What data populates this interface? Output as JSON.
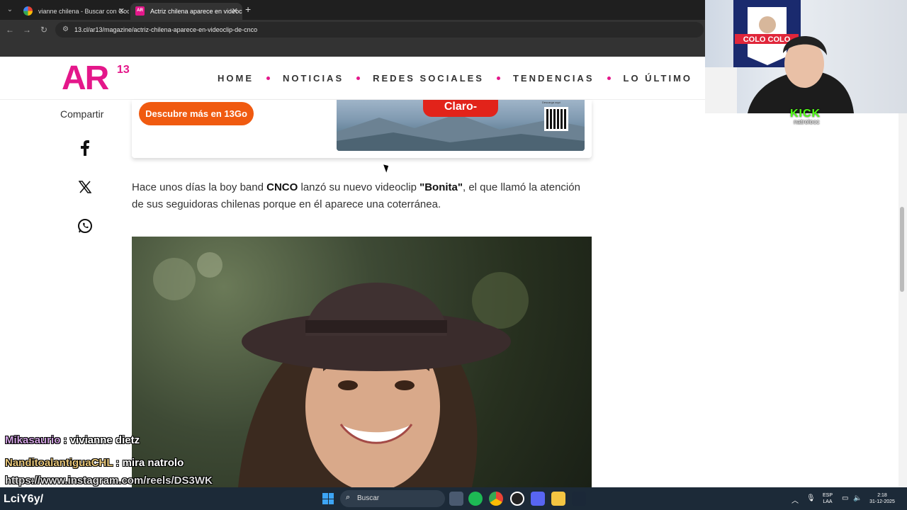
{
  "browser": {
    "tabs": [
      {
        "title": "vianne chilena - Buscar con Goo",
        "active": false
      },
      {
        "title": "Actriz chilena aparece en videoc",
        "active": true
      }
    ],
    "url": "13.cl/ar13/magazine/actriz-chilena-aparece-en-videoclip-de-cnco"
  },
  "site": {
    "logo": "AR",
    "logo_sup": "13",
    "nav": [
      "HOME",
      "NOTICIAS",
      "REDES SOCIALES",
      "TENDENCIAS",
      "LO ÚLTIMO"
    ]
  },
  "share": {
    "label": "Compartir",
    "icons": [
      "facebook-icon",
      "x-icon",
      "whatsapp-icon"
    ]
  },
  "promo": {
    "button": "Descubre más en 13Go",
    "brand": "Claro-",
    "qr_label": "Descarga aquí"
  },
  "article": {
    "p1_a": "Hace unos días la boy band ",
    "p1_b": "CNCO",
    "p1_c": " lanzó su nuevo videoclip ",
    "p1_d": "\"Bonita\"",
    "p1_e": ", el que llamó la atención de sus seguidoras chilenas porque en él aparece una coterránea."
  },
  "webcam": {
    "banner": "COLO COLO",
    "platform": "KICK",
    "user": "natrolocc"
  },
  "chat": [
    {
      "user": "Mikasaurio",
      "sep": " : ",
      "msg": "vivianne dietz"
    },
    {
      "user": "NanditoalantiguaCHL",
      "sep": " : ",
      "msg": "mira natrolo"
    },
    {
      "user": "https://www.instagram.com/reels/DS3WK",
      "sep": "",
      "msg": ""
    }
  ],
  "overlay_text": "LciY6y/",
  "taskbar": {
    "search": "Buscar",
    "lang": "ESP",
    "lang2": "LAA",
    "time": "2:18",
    "date": "31-12-2025"
  },
  "colors": {
    "brand": "#e4178a",
    "button": "#f05a10",
    "claro": "#e2231a"
  }
}
